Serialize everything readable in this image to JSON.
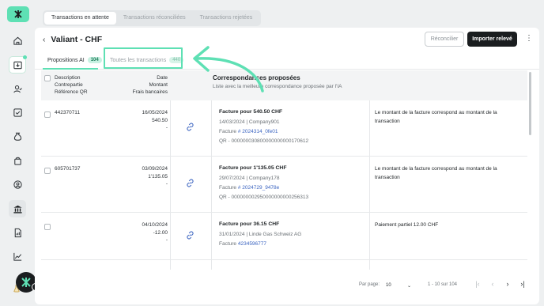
{
  "colors": {
    "accent": "#5ee0b4",
    "dark": "#1a1d1f",
    "link": "#3a63c0"
  },
  "top_tabs": [
    "Transactions en attente",
    "Transactions réconciliées",
    "Transactions rejetées"
  ],
  "header": {
    "title": "Valiant - CHF",
    "reconcile_label": "Réconcilier",
    "import_label": "Importer relevé"
  },
  "subtabs": [
    {
      "label": "Propositions AI",
      "count": "104"
    },
    {
      "label": "Toutes les transactions",
      "count": "440"
    }
  ],
  "table_header": {
    "description": "Description",
    "counterparty": "Contrepartie",
    "qr_reference": "Référence QR",
    "date": "Date",
    "amount": "Montant",
    "bank_fees": "Frais bancaires",
    "matches_title": "Correspondances proposées",
    "matches_subtitle": "Liste avec la meilleure correspondance proposée par l'IA"
  },
  "rows": [
    {
      "description": "442370711",
      "date": "16/05/2024",
      "amount": "540.50",
      "fees": "-",
      "match_title": "Facture pour 540.50 CHF",
      "match_meta": "14/03/2024 | Company901",
      "invoice_prefix": "Facture",
      "invoice_ref": "# 2024314_0fe01",
      "qr": "QR - 000000030800000000000170612",
      "reason": "Le montant de la facture correspond au montant de la transaction"
    },
    {
      "description": "605701737",
      "date": "03/09/2024",
      "amount": "1'135.05",
      "fees": "-",
      "match_title": "Facture pour 1'135.05 CHF",
      "match_meta": "29/07/2024 | Company178",
      "invoice_prefix": "Facture",
      "invoice_ref": "# 2024729_9478e",
      "qr": "QR - 000000002950000000000256313",
      "reason": "Le montant de la facture correspond au montant de la transaction"
    },
    {
      "description": "",
      "date": "04/10/2024",
      "amount": "-12.00",
      "fees": "-",
      "match_title": "Facture pour 36.15 CHF",
      "match_meta": "31/01/2024 | Linde Gas Schweiz AG",
      "invoice_prefix": "Facture",
      "invoice_ref": "4234596777",
      "qr": "",
      "reason": "Paiement partiel 12.00 CHF"
    }
  ],
  "footer": {
    "per_page_label": "Par page:",
    "per_page_value": "10",
    "range": "1 - 10 sur 104"
  },
  "avatar_badge": "60"
}
